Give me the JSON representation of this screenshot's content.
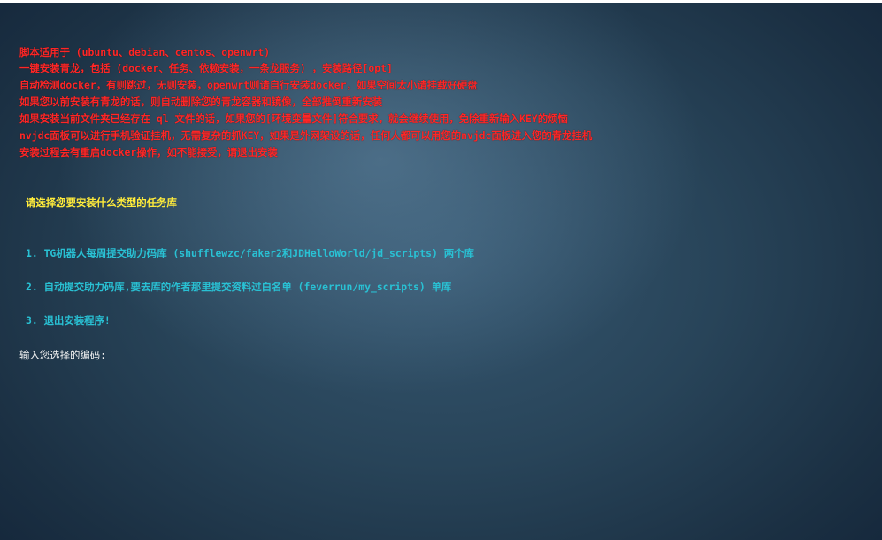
{
  "intro_lines": [
    "脚本适用于 (ubuntu、debian、centos、openwrt)",
    "一键安装青龙，包括 (docker、任务、依赖安装，一条龙服务) ，安装路径[opt]",
    "自动检测docker，有则跳过，无则安装，openwrt则请自行安装docker，如果空间太小请挂载好硬盘",
    "如果您以前安装有青龙的话，则自动删除您的青龙容器和镜像，全部推倒重新安装",
    "如果安装当前文件夹已经存在 ql 文件的话，如果您的[环境变量文件]符合要求，就会继续使用，免除重新输入KEY的烦恼",
    "nvjdc面板可以进行手机验证挂机，无需复杂的抓KEY，如果是外网架设的话，任何人都可以用您的nvjdc面板进入您的青龙挂机",
    "安装过程会有重启docker操作，如不能接受，请退出安装"
  ],
  "question": "请选择您要安装什么类型的任务库",
  "options": [
    "1. TG机器人每周提交助力码库 (shufflewzc/faker2和JDHelloWorld/jd_scripts) 两个库",
    "2. 自动提交助力码库,要去库的作者那里提交资料过白名单 (feverrun/my_scripts) 单库",
    "3. 退出安装程序!"
  ],
  "prompt": "输入您选择的编码:"
}
